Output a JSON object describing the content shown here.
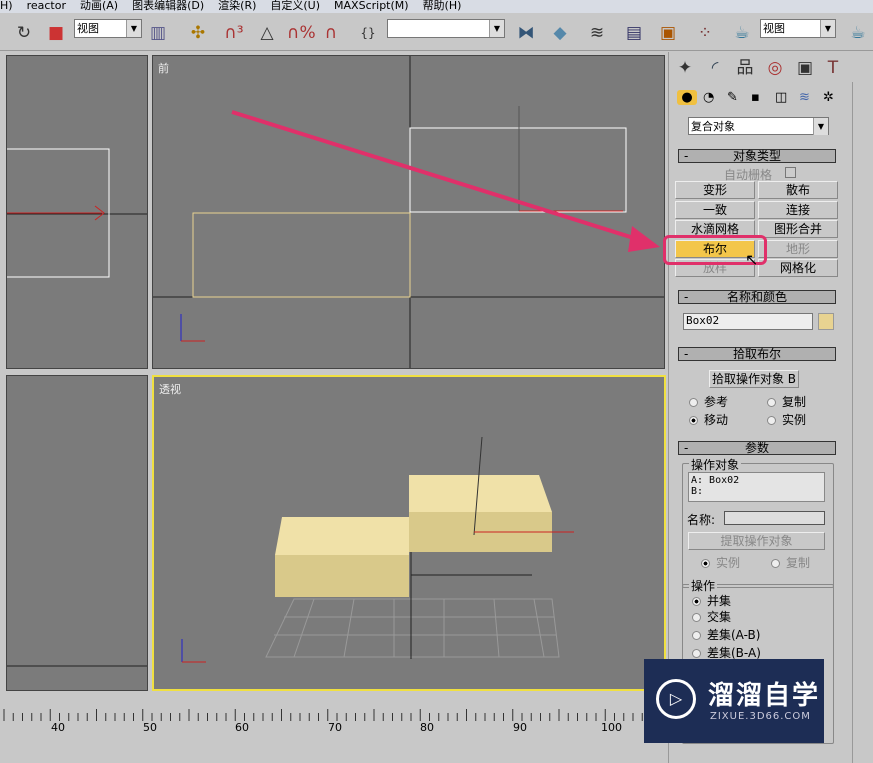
{
  "menu": [
    "H)",
    "reactor",
    "动画(A)",
    "图表编辑器(D)",
    "渲染(R)",
    "自定义(U)",
    "MAXScript(M)",
    "帮助(H)"
  ],
  "toolbar": {
    "view_select_left": "视图",
    "view_select_right": "视图",
    "named_selection": ""
  },
  "viewports": {
    "front": "前",
    "perspective": "透视"
  },
  "command_panel": {
    "category_dropdown": "复合对象",
    "object_type": {
      "title": "对象类型",
      "autogrid": "自动栅格",
      "buttons": [
        "变形",
        "散布",
        "一致",
        "连接",
        "水滴网格",
        "图形合并",
        "布尔",
        "地形",
        "放样",
        "网格化"
      ]
    },
    "name_color": {
      "title": "名称和颜色",
      "name": "Box02",
      "color": "#e8d391"
    },
    "pick_boolean": {
      "title": "拾取布尔",
      "pick_button": "拾取操作对象 B",
      "radios": [
        "参考",
        "复制",
        "移动",
        "实例"
      ]
    },
    "parameters": {
      "title": "参数",
      "operands_label": "操作对象",
      "operand_a": "A: Box02",
      "operand_b": "B:",
      "name_label": "名称:",
      "extract_button": "提取操作对象",
      "extract_radios": [
        "实例",
        "复制"
      ],
      "operation_label": "操作",
      "operations": [
        "并集",
        "交集",
        "差集(A-B)",
        "差集(B-A)"
      ]
    }
  },
  "timeline": {
    "ticks": [
      "40",
      "50",
      "60",
      "70",
      "80",
      "90",
      "100"
    ]
  },
  "watermark": {
    "title": "溜溜自学",
    "url": "ZIXUE.3D66.COM"
  },
  "colors": {
    "highlight": "#e0306a",
    "active_button": "#f3c64a",
    "active_viewport": "#f0e040"
  }
}
